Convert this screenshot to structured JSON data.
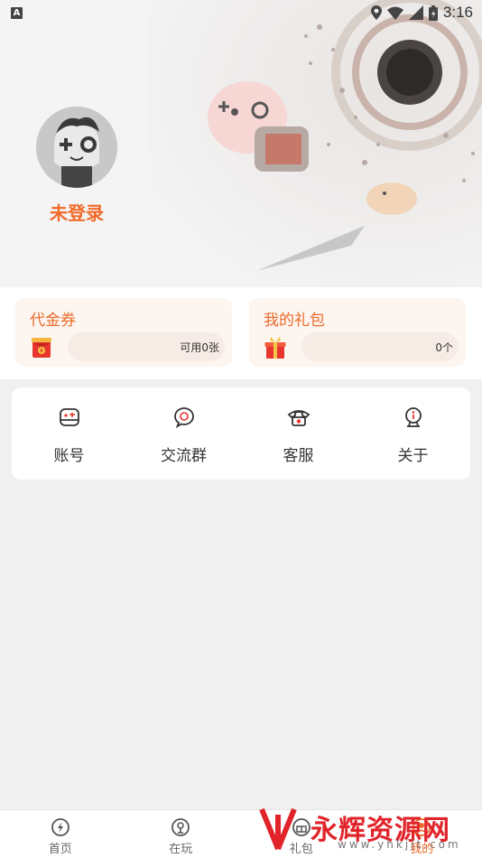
{
  "status_bar": {
    "time": "3:16",
    "notification_badge": "A"
  },
  "profile": {
    "login_text": "未登录"
  },
  "cards": [
    {
      "title": "代金券",
      "value": "可用0张",
      "icon": "red-envelope-icon"
    },
    {
      "title": "我的礼包",
      "value": "0个",
      "icon": "gift-box-icon"
    }
  ],
  "menu": [
    {
      "label": "账号",
      "icon": "account-icon"
    },
    {
      "label": "交流群",
      "icon": "chat-group-icon"
    },
    {
      "label": "客服",
      "icon": "phone-icon"
    },
    {
      "label": "关于",
      "icon": "info-icon"
    }
  ],
  "bottom_nav": [
    {
      "label": "首页",
      "icon": "home-icon",
      "active": false
    },
    {
      "label": "在玩",
      "icon": "playing-icon",
      "active": false
    },
    {
      "label": "礼包",
      "icon": "gift-icon",
      "active": false
    },
    {
      "label": "我的",
      "icon": "profile-icon",
      "active": true
    }
  ],
  "watermark": {
    "text": "永辉资源网",
    "url": "www.yhkjjt.com"
  },
  "colors": {
    "accent": "#f06a2a",
    "card_bg": "#fdf5ef",
    "page_bg": "#f0f0f0"
  }
}
